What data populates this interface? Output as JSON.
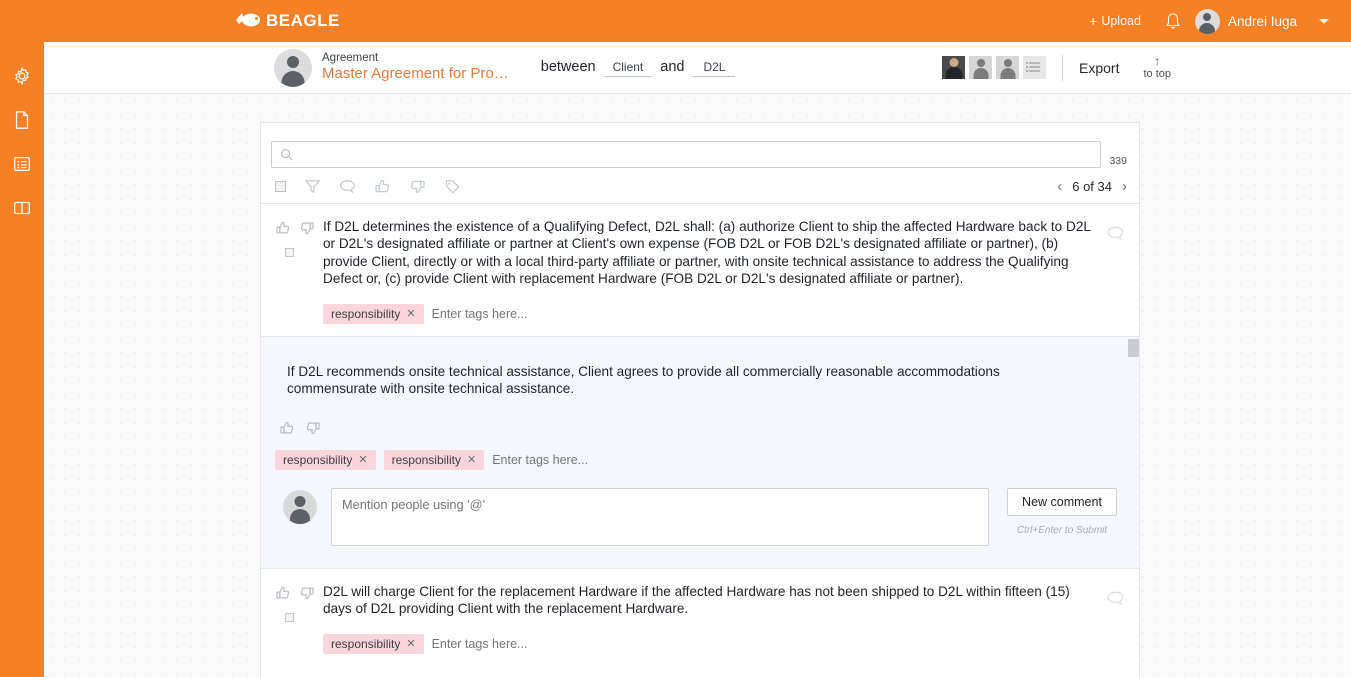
{
  "topbar": {
    "brand": "BEAGLE",
    "brand_icon": "beagle-dog-logo",
    "upload_label": "Upload",
    "upload_icon": "plus-icon",
    "notification_icon": "bell-icon",
    "user_name": "Andrei Iuga",
    "user_caret_icon": "chevron-down-icon",
    "accent_color": "#F58025"
  },
  "rail": {
    "items": [
      {
        "icon": "gear-icon",
        "name": "settings"
      },
      {
        "icon": "document-icon",
        "name": "document"
      },
      {
        "icon": "list-icon",
        "name": "list"
      },
      {
        "icon": "split-panel-icon",
        "name": "panels"
      }
    ]
  },
  "docheader": {
    "kind": "Agreement",
    "title": "Master Agreement for Pro…",
    "between_label": "between",
    "and_label": "and",
    "party_a": "Client",
    "party_b": "D2L",
    "collaborators": [
      "photo",
      "person",
      "person",
      "listicon"
    ],
    "export_label": "Export",
    "to_top_label": "to top",
    "to_top_arrow": "↑"
  },
  "search": {
    "placeholder": "",
    "value": "",
    "icon": "search-icon",
    "result_count": "339"
  },
  "toolbar": {
    "icons": [
      {
        "icon": "checkbox-icon",
        "name": "select-all"
      },
      {
        "icon": "filter-funnel-icon",
        "name": "filter"
      },
      {
        "icon": "comment-icon",
        "name": "comments"
      },
      {
        "icon": "thumbs-up-icon",
        "name": "approve"
      },
      {
        "icon": "thumbs-down-icon",
        "name": "reject"
      },
      {
        "icon": "tag-icon",
        "name": "tags"
      }
    ],
    "pagination": {
      "prev_icon": "chevron-left-icon",
      "next_icon": "chevron-right-icon",
      "label": "6 of 34"
    }
  },
  "clauses": [
    {
      "text": "If D2L determines the existence of a Qualifying Defect, D2L shall: (a) authorize Client to ship the affected Hardware back to D2L or D2L's designated affiliate or partner at Client's own expense (FOB D2L or FOB D2L's designated affiliate or partner), (b) provide Client, directly or with a local third-party affiliate or partner, with onsite technical assistance to address the Qualifying Defect or, (c) provide Client with replacement Hardware (FOB D2L or D2L's designated affiliate or partner).",
      "tags": [
        "responsibility"
      ],
      "tag_placeholder": "Enter tags here...",
      "tag_remove_glyph": "✕",
      "thumbs_up_icon": "thumbs-up-icon",
      "thumbs_down_icon": "thumbs-down-icon",
      "comment_icon": "comment-icon",
      "highlighted": false
    },
    {
      "text": "If D2L recommends onsite technical assistance, Client agrees to provide all commercially reasonable accommodations commensurate with onsite technical assistance.",
      "tags": [
        "responsibility",
        "responsibility"
      ],
      "tag_placeholder": "Enter tags here...",
      "tag_remove_glyph": "✕",
      "thumbs_up_icon": "thumbs-up-icon",
      "thumbs_down_icon": "thumbs-down-icon",
      "highlighted": true,
      "comment": {
        "placeholder": "Mention people using '@'",
        "value": "",
        "button_label": "New comment",
        "hint": "Ctrl+Enter to Submit"
      }
    },
    {
      "text": "D2L will charge Client for the replacement Hardware if the affected Hardware has not been shipped to D2L within fifteen (15) days of D2L providing Client with the replacement Hardware.",
      "tags": [
        "responsibility"
      ],
      "tag_placeholder": "Enter tags here...",
      "tag_remove_glyph": "✕",
      "thumbs_up_icon": "thumbs-up-icon",
      "thumbs_down_icon": "thumbs-down-icon",
      "comment_icon": "comment-icon",
      "highlighted": false
    }
  ],
  "colors": {
    "accent": "#F58025",
    "tag_bg": "#FBD5DC",
    "highlight_bg": "#F4F7FD",
    "title_orange": "#E07B39"
  }
}
